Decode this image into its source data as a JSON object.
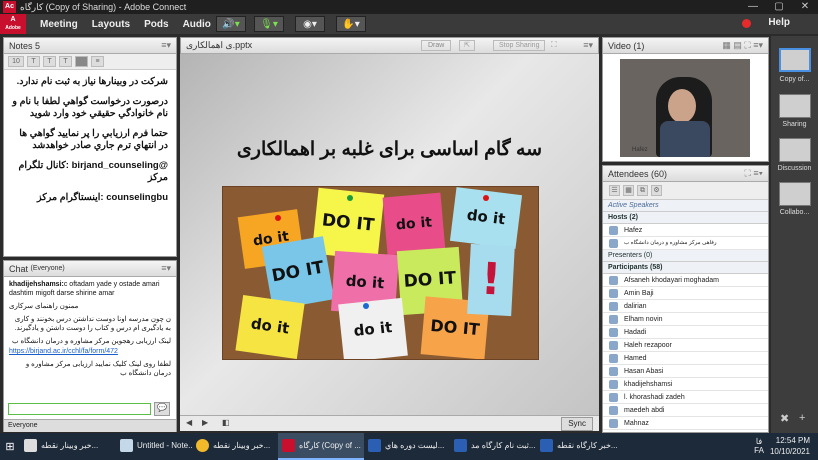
{
  "window": {
    "title": "کارگاه (Copy of Sharing) - Adobe Connect",
    "controls": [
      "—",
      "▢",
      "✕"
    ]
  },
  "menubar": {
    "items": [
      "Meeting",
      "Layouts",
      "Pods",
      "Audio"
    ],
    "help": "Help",
    "adobe": "Adobe"
  },
  "notes": {
    "title": "Notes 5",
    "font_size": "10",
    "lines": [
      "شرکت در وبینارها نیاز به ثبت نام ندارد.",
      "درصورت درخواست گواهي لطفا با نام و نام خانوادگي حقيقي خود وارد شويد",
      "حتما فرم ارزيابي را پر نماييد گواهي ها در انتهاي ترم جاري صادر خواهدشد",
      "@birjand_counseling :کانال تلگرام مرکز",
      "counselingbu :اینستاگرام مرکز"
    ]
  },
  "chat": {
    "title": "Chat",
    "scope": "(Everyone)",
    "messages": [
      {
        "name": "khadijehshamsi:",
        "text": "c oftadam yade y ostade amari dashtim migoft darse shirine amar"
      },
      {
        "name": "",
        "text": "ممنون راهنمای سرکاری"
      },
      {
        "name": "",
        "text": "ن چون مدرسه اونا دوست نداشتن درس بخونند و کاری به یادگیری ام درس و کتاب را دوست داشتن و یادگیرند."
      },
      {
        "name": "",
        "text": "لینک ارزیابی رهجوین مرکز مشاوره و درمان دانشگاه ب"
      },
      {
        "name": "",
        "text": "https://birjand.ac.ir/cchl/fa/form/472",
        "link": true
      },
      {
        "name": "",
        "text": "لطفا روی لینک کلیک نمایید ارزیابی مرکز مشاوره و درمان دانشگاه ب"
      }
    ],
    "recipient": "Everyone"
  },
  "share": {
    "title": "ی اهمالکاری.pptx",
    "draw": "Draw",
    "stop": "Stop Sharing",
    "slide_title": "سه گام اساسی برای غلبه بر اهمالکاری",
    "notes_text": [
      "do it",
      "DO IT",
      "do it",
      "do it",
      "DO IT",
      "do it",
      "DO IT",
      "do it",
      "do it",
      "DO IT",
      "!"
    ],
    "sync": "Sync"
  },
  "video": {
    "title": "Video",
    "count": "(1)",
    "person": "Hafez"
  },
  "attendees": {
    "title": "Attendees",
    "count": "(60)",
    "active_speakers": "Active Speakers",
    "hosts_label": "Hosts (2)",
    "hosts": [
      "Hafez",
      "رفاهی مرکز مشاوره و درمان دانشگاه ب"
    ],
    "presenters_label": "Presenters (0)",
    "participants_label": "Participants (58)",
    "participants": [
      "Afsaneh khodayari moghadam",
      "Amin Baji",
      "dalirian",
      "Elham novin",
      "Hadadi",
      "Haleh rezapoor",
      "Hamed",
      "Hasan Abasi",
      "khadijehshamsi",
      "l. khorashadi zadeh",
      "maedeh abdi",
      "Mahnaz"
    ]
  },
  "layouts": [
    "Copy of...",
    "Sharing",
    "Discussion",
    "Collabo..."
  ],
  "taskbar": {
    "items": [
      "خبر وبينار نقطه...",
      "Untitled - Note...",
      "خبر وبينار نقطه...",
      "کارگاه (Copy of ...",
      "ليست دوره هاي...",
      "ثبت نام کارگاه مد...",
      "خبر کارگاه نقطه..."
    ],
    "lang": "FA",
    "lang2": "فا",
    "time": "12:54 PM",
    "date": "10/10/2021"
  }
}
